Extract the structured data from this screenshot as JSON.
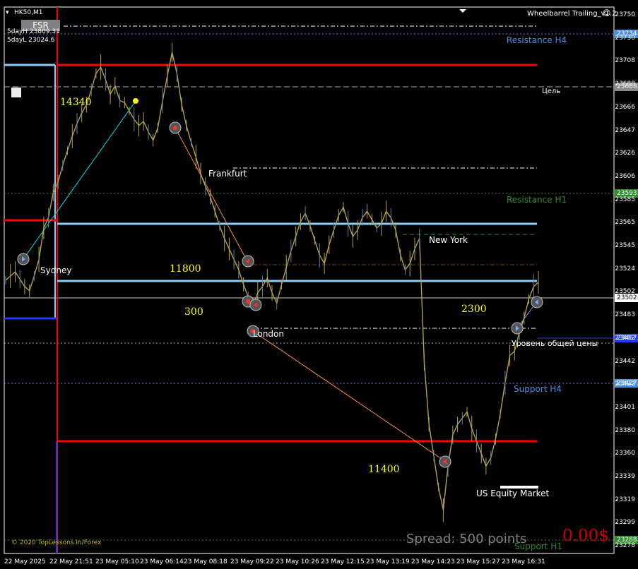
{
  "header": {
    "symbol": "HK50,M1",
    "indicator": "Wheelbarrel Trailing_v1.2",
    "fsr_button": "FSR",
    "day_high": "5dayH 23809.31",
    "day_low": "5dayL 23024.6"
  },
  "colors": {
    "background": "#000000",
    "candles": "#b3a14a",
    "red_level": "#ff0000",
    "light_blue_level": "#87cefa",
    "blue_level": "#1e3cff",
    "yellow_text": "#ffff00",
    "resistance_h4": "#4a90e2",
    "resistance_h1": "#2e8b2e",
    "spread": "#808080",
    "profit": "#cc0000"
  },
  "levels": {
    "resistance_h4": "Resistance H4",
    "target": "Цель",
    "resistance_h1": "Resistance H1",
    "general_price": "Уровень общей цены",
    "support_h4": "Support H4",
    "us_equity": "US Equity Market",
    "support_h1": "Support H1"
  },
  "sessions": {
    "sydney": "Sydney",
    "frankfurt": "Frankfurt",
    "london": "London",
    "new_york": "New York"
  },
  "range_labels": {
    "r1": "14340",
    "r2": "11800",
    "r3": "300",
    "r4": "2300",
    "r5": "11400"
  },
  "price_tags": {
    "p1": "23734.",
    "p2": "23688.",
    "p3": "23593.",
    "p4": "23502.",
    "p5": "23467.",
    "p6": "23427.",
    "p7": "23288."
  },
  "footer": {
    "copyright": "© 2020 TopLessons.In/Forex",
    "spread": "Spread: 500 points",
    "profit": "0.00$"
  },
  "chart_data": {
    "type": "line",
    "title": "HK50,M1",
    "y_ticks": [
      "23750",
      "23730",
      "23708",
      "23688",
      "23666",
      "23647",
      "23626",
      "23606",
      "23585",
      "23565",
      "23545",
      "23524",
      "23502",
      "23483",
      "23462",
      "23442",
      "23422",
      "23401",
      "23380",
      "23360",
      "23339",
      "23319",
      "23299",
      "23278"
    ],
    "x_ticks": [
      "22 May 2025",
      "22 May 21:51",
      "23 May 05:10",
      "23 May 06:14",
      "23 May 08:18",
      "23 May 09:22",
      "23 May 10:26",
      "23 May 12:15",
      "23 May 13:19",
      "23 May 14:23",
      "23 May 15:27",
      "23 May 16:31"
    ],
    "ylim": [
      23270,
      23770
    ],
    "series": [
      {
        "values": [
          23518,
          23522,
          23526,
          23519,
          23512,
          23508,
          23522,
          23538,
          23568,
          23578,
          23602,
          23612,
          23628,
          23642,
          23656,
          23668,
          23678,
          23686,
          23700,
          23716,
          23722,
          23710,
          23696,
          23704,
          23690,
          23688,
          23680,
          23672,
          23666,
          23670,
          23660,
          23652,
          23664,
          23690,
          23714,
          23736,
          23716,
          23686,
          23666,
          23650,
          23636,
          23620,
          23608,
          23598,
          23584,
          23570,
          23558,
          23548,
          23538,
          23528,
          23514,
          23502,
          23494,
          23506,
          23512,
          23520,
          23506,
          23496,
          23514,
          23530,
          23546,
          23560,
          23574,
          23582,
          23570,
          23556,
          23542,
          23534,
          23552,
          23566,
          23580,
          23588,
          23572,
          23560,
          23566,
          23578,
          23584,
          23576,
          23568,
          23572,
          23584,
          23578,
          23566,
          23542,
          23528,
          23534,
          23548,
          23558,
          23440,
          23380,
          23350,
          23320,
          23298,
          23340,
          23370,
          23380,
          23386,
          23392,
          23376,
          23364,
          23352,
          23340,
          23348,
          23366,
          23390,
          23420,
          23446,
          23450,
          23468,
          23482,
          23500,
          23512,
          23516
        ]
      }
    ]
  }
}
